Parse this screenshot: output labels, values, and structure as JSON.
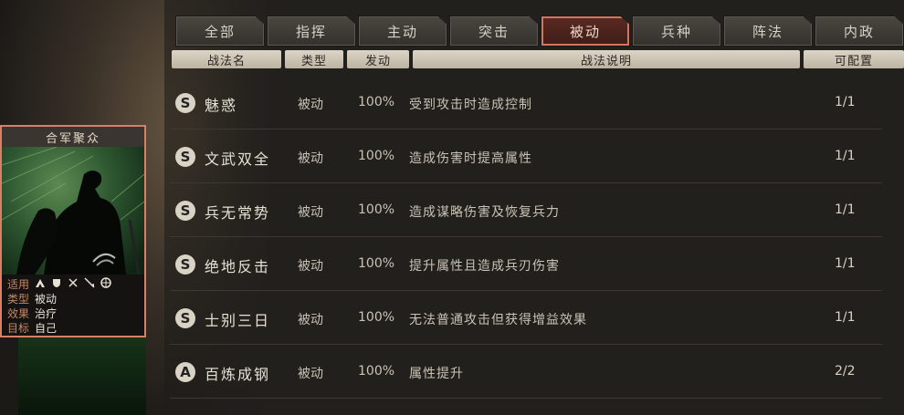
{
  "tabs": [
    {
      "label": "全部",
      "active": false
    },
    {
      "label": "指挥",
      "active": false
    },
    {
      "label": "主动",
      "active": false
    },
    {
      "label": "突击",
      "active": false
    },
    {
      "label": "被动",
      "active": true
    },
    {
      "label": "兵种",
      "active": false
    },
    {
      "label": "阵法",
      "active": false
    },
    {
      "label": "内政",
      "active": false
    }
  ],
  "headers": {
    "name": "战法名",
    "type": "类型",
    "rate": "发动",
    "desc": "战法说明",
    "config": "可配置"
  },
  "rows": [
    {
      "grade": "S",
      "name": "魅惑",
      "type": "被动",
      "rate": "100%",
      "desc": "受到攻击时造成控制",
      "config": "1/1"
    },
    {
      "grade": "S",
      "name": "文武双全",
      "type": "被动",
      "rate": "100%",
      "desc": "造成伤害时提高属性",
      "config": "1/1"
    },
    {
      "grade": "S",
      "name": "兵无常势",
      "type": "被动",
      "rate": "100%",
      "desc": "造成谋略伤害及恢复兵力",
      "config": "1/1"
    },
    {
      "grade": "S",
      "name": "绝地反击",
      "type": "被动",
      "rate": "100%",
      "desc": "提升属性且造成兵刃伤害",
      "config": "1/1"
    },
    {
      "grade": "S",
      "name": "士别三日",
      "type": "被动",
      "rate": "100%",
      "desc": "无法普通攻击但获得增益效果",
      "config": "1/1"
    },
    {
      "grade": "A",
      "name": "百炼成钢",
      "type": "被动",
      "rate": "100%",
      "desc": "属性提升",
      "config": "2/2"
    }
  ],
  "card": {
    "title": "合军聚众",
    "use_label": "适用",
    "type_label": "类型",
    "type_value": "被动",
    "effect_label": "效果",
    "effect_value": "治疗",
    "target_label": "目标",
    "target_value": "自己",
    "unit_icons": [
      "cavalry-icon",
      "shield-icon",
      "bow-icon",
      "spear-icon",
      "siege-icon"
    ],
    "accent_color": "#d97f66"
  }
}
